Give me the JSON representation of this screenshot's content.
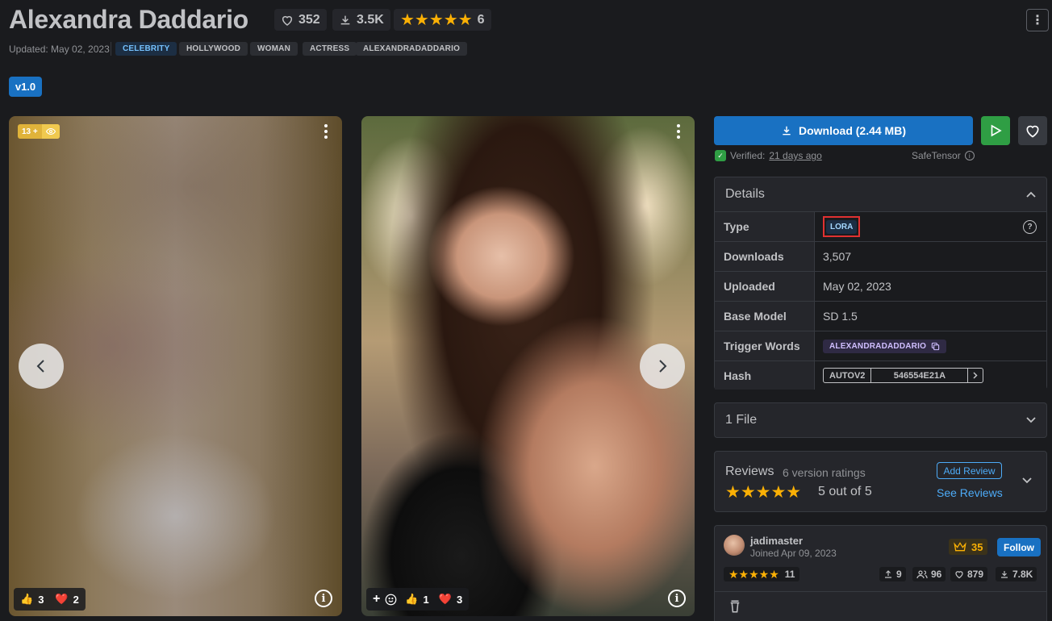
{
  "model": {
    "title": "Alexandra Daddario",
    "likes": "352",
    "downloads": "3.5K",
    "rating_count": "6",
    "rating": 5,
    "updated": "Updated: May 02, 2023",
    "tags": [
      "CELEBRITY",
      "HOLLYWOOD",
      "WOMAN",
      "ACTRESS",
      "ALEXANDRADADDARIO"
    ],
    "version": "v1.0"
  },
  "gallery": {
    "card1": {
      "nsfw_badge": "13 +",
      "reaction_like": "3",
      "reaction_heart": "2"
    },
    "card2": {
      "reaction_like": "1",
      "reaction_heart": "3"
    }
  },
  "actions": {
    "download_label": "Download (2.44 MB)",
    "verified_prefix": "Verified:",
    "verified_when": "21 days ago",
    "safetensor": "SafeTensor"
  },
  "details": {
    "header": "Details",
    "rows": {
      "type": {
        "label": "Type",
        "value": "LORA"
      },
      "downloads": {
        "label": "Downloads",
        "value": "3,507"
      },
      "uploaded": {
        "label": "Uploaded",
        "value": "May 02, 2023"
      },
      "base_model": {
        "label": "Base Model",
        "value": "SD 1.5"
      },
      "trigger_words": {
        "label": "Trigger Words",
        "value": "ALEXANDRADADDARIO"
      },
      "hash": {
        "label": "Hash",
        "type": "AUTOV2",
        "value": "546554E21A"
      }
    }
  },
  "files": {
    "label": "1 File"
  },
  "reviews": {
    "title": "Reviews",
    "subtitle": "6 version ratings",
    "score": "5 out of 5",
    "add_review": "Add Review",
    "see_reviews": "See Reviews"
  },
  "creator": {
    "name": "jadimaster",
    "joined": "Joined Apr 09, 2023",
    "crown_count": "35",
    "follow": "Follow",
    "rating_count": "11",
    "uploads": "9",
    "followers": "96",
    "favorites": "879",
    "downloads": "7.8K"
  },
  "colors": {
    "accent": "#1971c2",
    "star": "#fab005",
    "play": "#2f9e44",
    "highlight": "#e03131"
  }
}
